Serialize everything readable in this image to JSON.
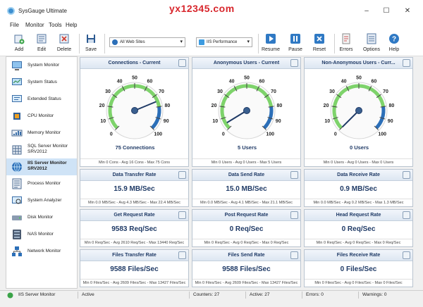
{
  "window": {
    "title": "SysGauge Ultimate",
    "watermark": "yx12345.com"
  },
  "menu": [
    "File",
    "Monitor",
    "Tools",
    "Help"
  ],
  "toolbar": {
    "add": "Add",
    "edit": "Edit",
    "delete": "Delete",
    "save": "Save",
    "resume": "Resume",
    "pause": "Pause",
    "reset": "Reset",
    "errors": "Errors",
    "options": "Options",
    "help": "Help",
    "site_select": "All Web Sites",
    "perf_select": "IIS Performance"
  },
  "sidebar": [
    {
      "label": "System Monitor",
      "icon": "system-monitor-icon"
    },
    {
      "label": "System Status",
      "icon": "system-status-icon"
    },
    {
      "label": "Extended Status",
      "icon": "extended-status-icon"
    },
    {
      "label": "CPU Monitor",
      "icon": "cpu-icon"
    },
    {
      "label": "Memory Monitor",
      "icon": "memory-icon"
    },
    {
      "label": "SQL Server Monitor",
      "sublabel": "SRV2012",
      "icon": "sql-server-icon"
    },
    {
      "label": "IIS Server Monitor",
      "sublabel": "SRV2012",
      "icon": "iis-server-icon"
    },
    {
      "label": "Process Monitor",
      "icon": "process-icon"
    },
    {
      "label": "System Analyzer",
      "icon": "analyzer-icon"
    },
    {
      "label": "Disk Monitor",
      "icon": "disk-icon"
    },
    {
      "label": "NAS Monitor",
      "icon": "nas-icon"
    },
    {
      "label": "Network Monitor",
      "icon": "network-icon"
    }
  ],
  "gauges": [
    {
      "title": "Connections - Current",
      "value": "75 Connections",
      "needle": 75,
      "footer": "Min 0 Cons - Avg 16 Cons - Max 75 Cons"
    },
    {
      "title": "Anonymous Users - Current",
      "value": "5 Users",
      "needle": 5,
      "footer": "Min 0 Users - Avg 0 Users - Max 5 Users"
    },
    {
      "title": "Non-Anonymous Users - Curr...",
      "value": "0 Users",
      "needle": 0,
      "footer": "Min 0 Users - Avg 0 Users - Max 0 Users"
    }
  ],
  "gauge_ticks": [
    "0",
    "10",
    "20",
    "30",
    "40",
    "50",
    "60",
    "70",
    "80",
    "90",
    "100"
  ],
  "tiles": [
    {
      "title": "Data Transfer Rate",
      "value": "15.9 MB/Sec",
      "footer": "Min 0.0 MB/Sec - Avg 4.3 MB/Sec - Max 22.4 MB/Sec"
    },
    {
      "title": "Data Send Rate",
      "value": "15.0 MB/Sec",
      "footer": "Min 0.0 MB/Sec - Avg 4.1 MB/Sec - Max 21.1 MB/Sec"
    },
    {
      "title": "Data Receive Rate",
      "value": "0.9 MB/Sec",
      "footer": "Min 0.0 MB/Sec - Avg 0.2 MB/Sec - Max 1.3 MB/Sec"
    },
    {
      "title": "Get Request Rate",
      "value": "9583 Req/Sec",
      "footer": "Min 0 Req/Sec - Avg 2610 Req/Sec - Max 13440 Req/Sec"
    },
    {
      "title": "Post Request Rate",
      "value": "0 Req/Sec",
      "footer": "Min 0 Req/Sec - Avg 0 Req/Sec - Max 0 Req/Sec"
    },
    {
      "title": "Head Request Rate",
      "value": "0 Req/Sec",
      "footer": "Min 0 Req/Sec - Avg 0 Req/Sec - Max 0 Req/Sec"
    },
    {
      "title": "Files Transfer Rate",
      "value": "9588 Files/Sec",
      "footer": "Min 0 Files/Sec - Avg 2609 Files/Sec - Max 13427 Files/Sec"
    },
    {
      "title": "Files Send Rate",
      "value": "9588 Files/Sec",
      "footer": "Min 0 Files/Sec - Avg 2609 Files/Sec - Max 13427 Files/Sec"
    },
    {
      "title": "Files Receive Rate",
      "value": "0 Files/Sec",
      "footer": "Min 0 Files/Sec - Avg 0 Files/Sec - Max 0 Files/Sec"
    }
  ],
  "status": {
    "monitor": "IIS Server Monitor",
    "state": "Active",
    "counters": "Counters: 27",
    "active": "Active: 27",
    "errors": "Errors: 0",
    "warnings": "Warnings: 0"
  },
  "colors": {
    "accent": "#1f3a66",
    "gauge_green": "#7ed36b",
    "gauge_blue": "#2c6fb8",
    "watermark": "#d8262c",
    "selected": "#cfe3f6"
  }
}
